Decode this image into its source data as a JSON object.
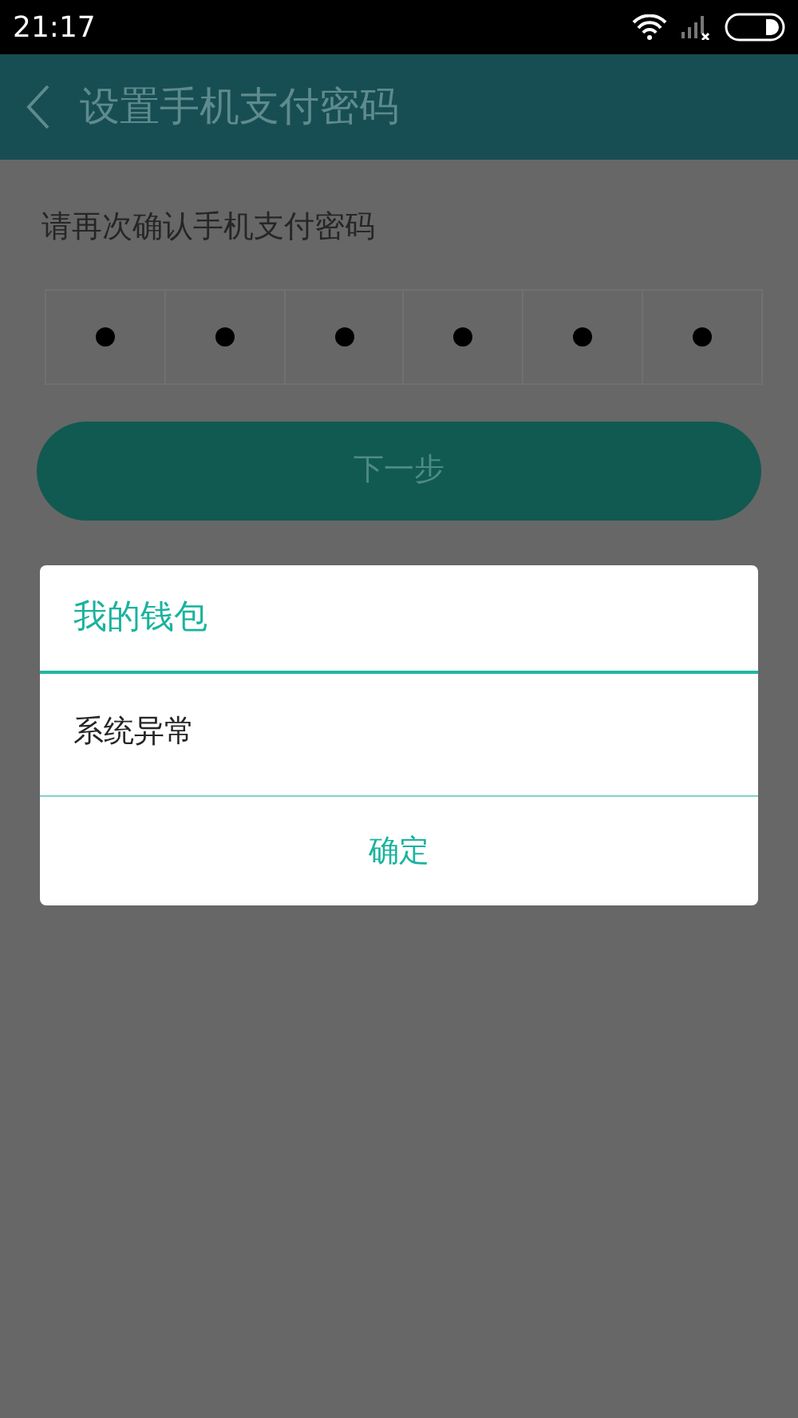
{
  "status_bar": {
    "time": "21:17"
  },
  "header": {
    "title": "设置手机支付密码"
  },
  "prompt": "请再次确认手机支付密码",
  "pin": {
    "digits": [
      {
        "filled": true
      },
      {
        "filled": true
      },
      {
        "filled": true
      },
      {
        "filled": true
      },
      {
        "filled": true
      },
      {
        "filled": true
      }
    ]
  },
  "next_button": {
    "label": "下一步",
    "disabled": true
  },
  "dialog": {
    "title": "我的钱包",
    "message": "系统异常",
    "buttons": [
      "确定"
    ]
  }
}
